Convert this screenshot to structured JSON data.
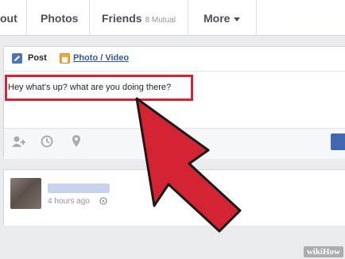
{
  "tabs": {
    "about_partial": "out",
    "photos": "Photos",
    "friends": "Friends",
    "friends_count": "8 Mutual",
    "more": "More"
  },
  "composer": {
    "post_tab": "Post",
    "photo_video_tab": "Photo / Video",
    "text": "Hey what's up? what are you doing there?",
    "icons": [
      "tag-friends-icon",
      "clock-icon",
      "location-pin-icon"
    ]
  },
  "feed": {
    "timestamp": "4 hours ago"
  },
  "annotation": {
    "highlight_color": "#d42433",
    "arrow_color": "#d42433"
  },
  "watermark": "wikiHow",
  "colors": {
    "brand": "#4267b2",
    "background": "#e9ebee"
  }
}
